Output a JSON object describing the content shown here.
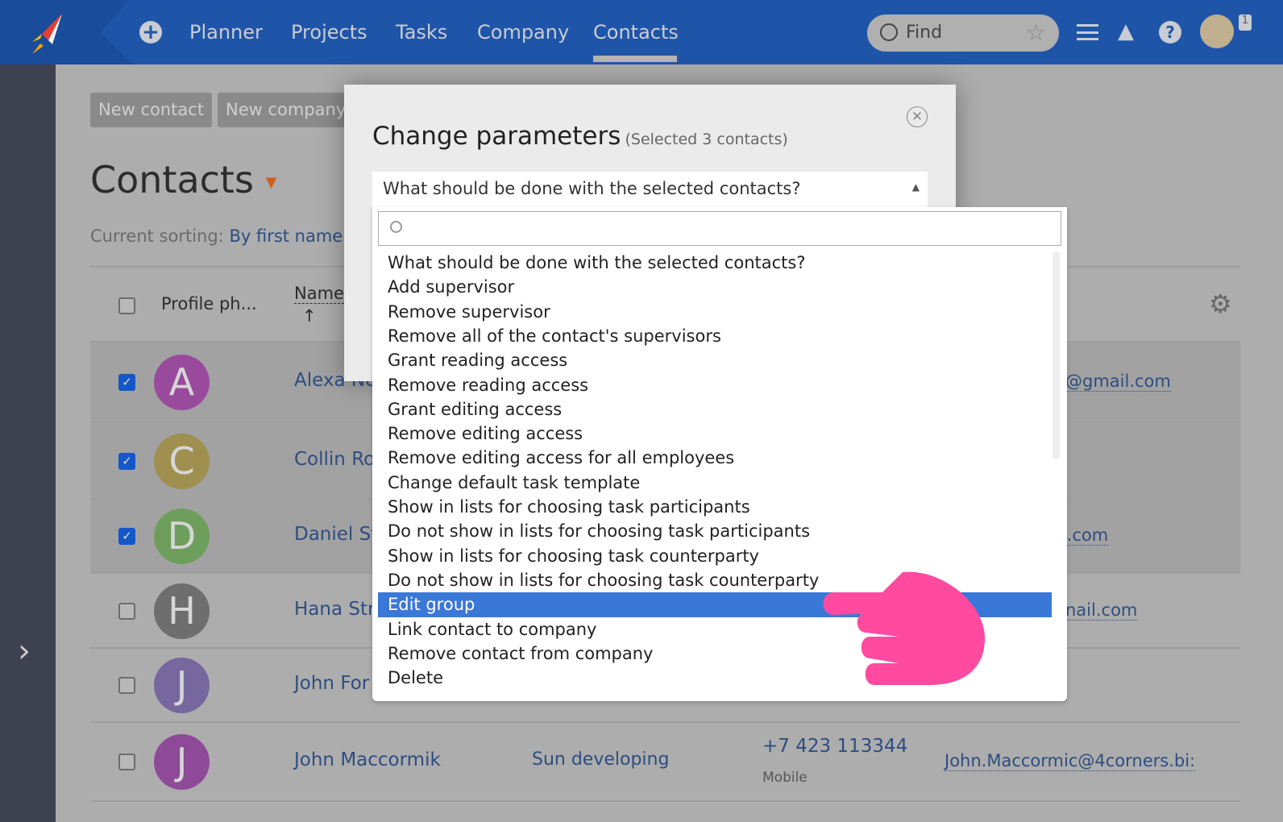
{
  "header": {
    "nav": [
      "Planner",
      "Projects",
      "Tasks",
      "Company",
      "Contacts"
    ],
    "active": "Contacts",
    "find_placeholder": "Find",
    "notifications": "1",
    "accent": "#1f55a8"
  },
  "toolbar": {
    "new_contact": "New contact",
    "new_company": "New company"
  },
  "page": {
    "title": "Contacts",
    "sorting_label": "Current sorting:",
    "sorting_value": "By first name"
  },
  "table": {
    "headers": {
      "photo": "Profile ph...",
      "name": "Name",
      "sort_arrow": "↑"
    },
    "rows": [
      {
        "initial": "A",
        "color": "#9a4a9c",
        "name": "Alexa No",
        "email": "@gmail.com",
        "checked": true
      },
      {
        "initial": "C",
        "color": "#a09050",
        "name": "Collin Ro",
        "email": "",
        "checked": true
      },
      {
        "initial": "D",
        "color": "#6e9e5c",
        "name": "Daniel St",
        "email": "il.com",
        "checked": true
      },
      {
        "initial": "H",
        "color": "#6e6e6e",
        "name": "Hana Str",
        "email": "nail.com",
        "checked": false
      },
      {
        "initial": "J",
        "color": "#76679e",
        "name": "John For",
        "email": "",
        "checked": false
      },
      {
        "initial": "J",
        "color": "#8e4a98",
        "name": "John Maccormik",
        "company": "Sun developing",
        "phone": "+7 423 113344",
        "phone_type": "Mobile",
        "email": "John.Maccormic@4corners.bi:",
        "checked": false
      }
    ]
  },
  "modal": {
    "title": "Change parameters",
    "subtitle": "(Selected 3 contacts)",
    "select_value": "What should be done with the selected contacts?",
    "options": [
      "What should be done with the selected contacts?",
      "Add supervisor",
      "Remove supervisor",
      "Remove all of the contact's supervisors",
      "Grant reading access",
      "Remove reading access",
      "Grant editing access",
      "Remove editing access",
      "Remove editing access for all employees",
      "Change default task template",
      "Show in lists for choosing task participants",
      "Do not show in lists for choosing task participants",
      "Show in lists for choosing task counterparty",
      "Do not show in lists for choosing task counterparty",
      "Edit group",
      "Link contact to company",
      "Remove contact from company",
      "Delete"
    ],
    "highlighted": "Edit group",
    "highlight_color": "#3a78d8"
  }
}
